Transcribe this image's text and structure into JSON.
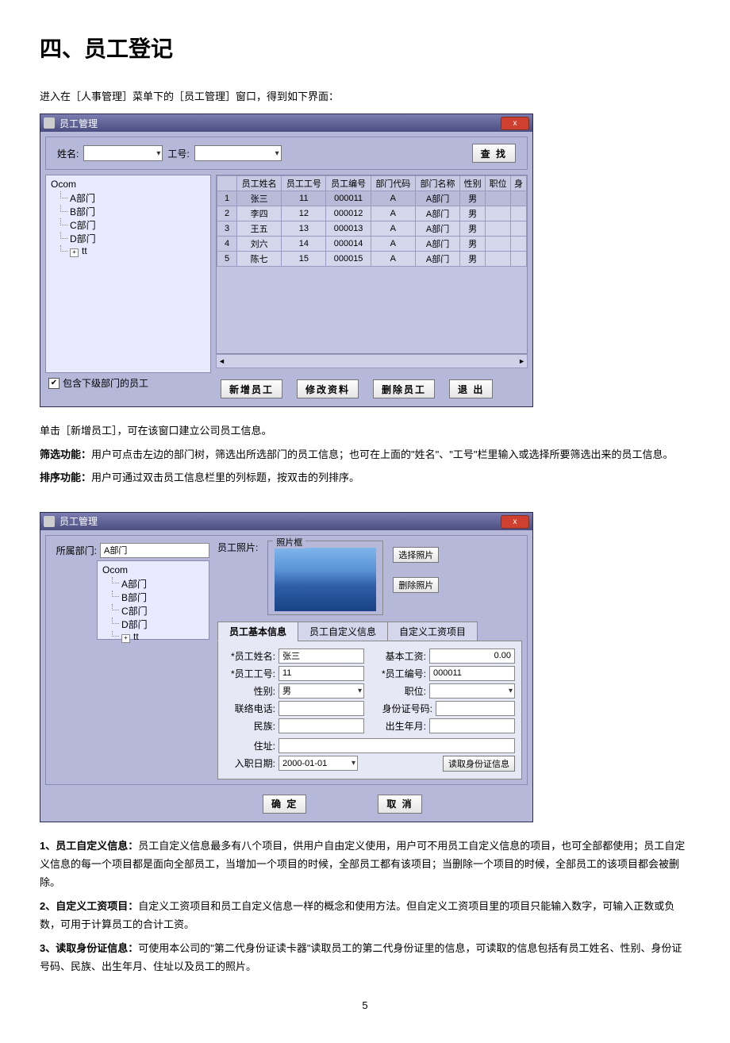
{
  "heading": "四、员工登记",
  "intro": "进入在［人事管理］菜单下的［员工管理］窗口，得到如下界面：",
  "win1": {
    "title": "员工管理",
    "close": "x",
    "name_label": "姓名:",
    "id_label": "工号:",
    "search_btn": "查 找",
    "tree": {
      "root": "Ocom",
      "items": [
        "A部门",
        "B部门",
        "C部门",
        "D部门"
      ],
      "tt": "tt"
    },
    "columns": [
      "员工姓名",
      "员工工号",
      "员工编号",
      "部门代码",
      "部门名称",
      "性别",
      "职位",
      "身"
    ],
    "rows": [
      {
        "n": "1",
        "name": "张三",
        "no": "11",
        "code": "000011",
        "dc": "A",
        "dn": "A部门",
        "sex": "男"
      },
      {
        "n": "2",
        "name": "李四",
        "no": "12",
        "code": "000012",
        "dc": "A",
        "dn": "A部门",
        "sex": "男"
      },
      {
        "n": "3",
        "name": "王五",
        "no": "13",
        "code": "000013",
        "dc": "A",
        "dn": "A部门",
        "sex": "男"
      },
      {
        "n": "4",
        "name": "刘六",
        "no": "14",
        "code": "000014",
        "dc": "A",
        "dn": "A部门",
        "sex": "男"
      },
      {
        "n": "5",
        "name": "陈七",
        "no": "15",
        "code": "000015",
        "dc": "A",
        "dn": "A部门",
        "sex": "男"
      }
    ],
    "include_sub": "包含下级部门的员工",
    "btn_new": "新增员工",
    "btn_edit": "修改资料",
    "btn_del": "删除员工",
    "btn_exit": "退 出"
  },
  "para1": "单击［新增员工］，可在该窗口建立公司员工信息。",
  "para2a": "筛选功能：",
  "para2b": "用户可点击左边的部门树，筛选出所选部门的员工信息；也可在上面的\"姓名\"、\"工号\"栏里输入或选择所要筛选出来的员工信息。",
  "para3a": "排序功能：",
  "para3b": "用户可通过双击员工信息栏里的列标题，按双击的列排序。",
  "win2": {
    "title": "员工管理",
    "dept_label": "所属部门:",
    "dept_value": "A部门",
    "tree": {
      "root": "Ocom",
      "items": [
        "A部门",
        "B部门",
        "C部门",
        "D部门"
      ],
      "tt": "tt"
    },
    "photo_label": "员工照片:",
    "photo_frame": "照片框",
    "btn_sel_photo": "选择照片",
    "btn_del_photo": "删除照片",
    "tabs": [
      "员工基本信息",
      "员工自定义信息",
      "自定义工资项目"
    ],
    "f_name_l": "*员工姓名:",
    "f_name_v": "张三",
    "f_no_l": "*员工工号:",
    "f_no_v": "11",
    "f_sex_l": "性别:",
    "f_sex_v": "男",
    "f_phone_l": "联络电话:",
    "f_nation_l": "民族:",
    "f_addr_l": "住址:",
    "f_hire_l": "入职日期:",
    "f_hire_v": "2000-01-01",
    "f_salary_l": "基本工资:",
    "f_salary_v": "0.00",
    "f_code_l": "*员工编号:",
    "f_code_v": "000011",
    "f_pos_l": "职位:",
    "f_idno_l": "身份证号码:",
    "f_birth_l": "出生年月:",
    "btn_readid": "读取身份证信息",
    "btn_ok": "确 定",
    "btn_cancel": "取 消"
  },
  "note1a": "1、员工自定义信息：",
  "note1b": "员工自定义信息最多有八个项目，供用户自由定义使用，用户可不用员工自定义信息的项目，也可全部都使用；员工自定义信息的每一个项目都是面向全部员工，当增加一个项目的时候，全部员工都有该项目；当删除一个项目的时候，全部员工的该项目都会被删除。",
  "note2a": "2、自定义工资项目：",
  "note2b": "自定义工资项目和员工自定义信息一样的概念和使用方法。但自定义工资项目里的项目只能输入数字，可输入正数或负数，可用于计算员工的合计工资。",
  "note3a": "3、读取身份证信息：",
  "note3b": "可使用本公司的\"第二代身份证读卡器\"读取员工的第二代身份证里的信息，可读取的信息包括有员工姓名、性别、身份证号码、民族、出生年月、住址以及员工的照片。",
  "page": "5"
}
